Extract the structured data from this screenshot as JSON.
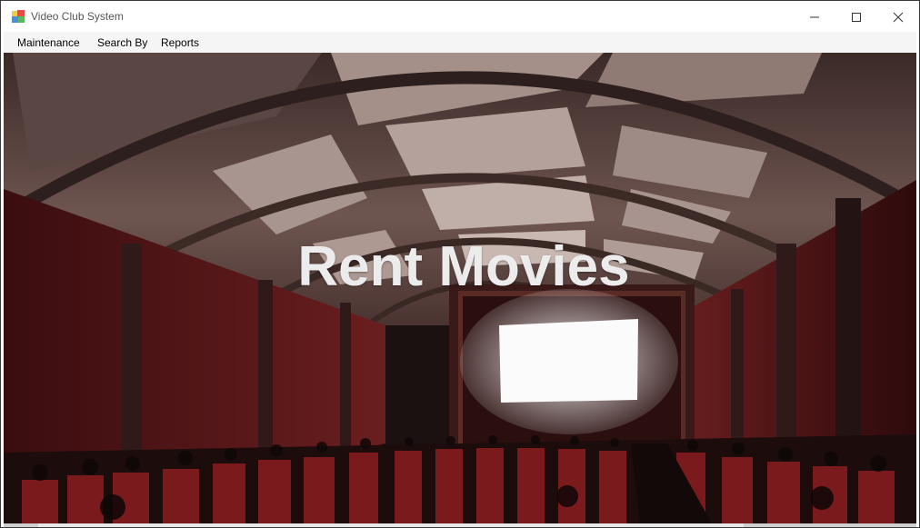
{
  "window": {
    "title": "Video Club System",
    "controls": {
      "minimize_icon": "minimize-icon",
      "maximize_icon": "maximize-icon",
      "close_icon": "close-icon"
    }
  },
  "menubar": {
    "items": [
      {
        "label": "Maintenance"
      },
      {
        "label": "Search By"
      },
      {
        "label": "Reports"
      }
    ]
  },
  "main": {
    "hero_title": "Rent Movies",
    "background_image": "cinema-theater-image"
  },
  "colors": {
    "titlebar": "#ffffff",
    "menubar": "#f5f5f5",
    "hero_text": "#ececec",
    "wall_red": "#6b1e1e",
    "ceiling": "#8a6f6a"
  }
}
